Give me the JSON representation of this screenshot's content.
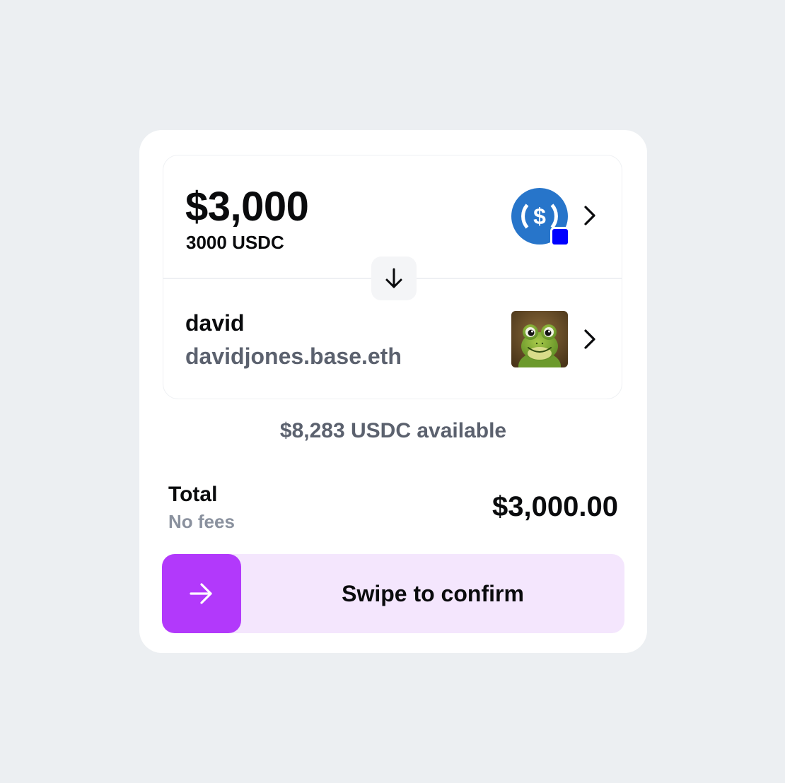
{
  "colors": {
    "background": "#eceff2",
    "card": "#ffffff",
    "usdc_blue": "#2775ca",
    "network_badge": "#0000ff",
    "swipe_track": "#f4e6fd",
    "swipe_handle": "#b239fb",
    "muted_text": "#5b616e"
  },
  "send": {
    "amount": "$3,000",
    "amount_token": "3000 USDC",
    "token_icon": "usdc-icon",
    "network_badge_icon": "base-network-icon"
  },
  "swap_icon": "arrow-down-icon",
  "recipient": {
    "name": "david",
    "address": "davidjones.base.eth",
    "avatar": "frog-avatar"
  },
  "available": "$8,283 USDC available",
  "total": {
    "label": "Total",
    "fees": "No fees",
    "value": "$3,000.00"
  },
  "confirm": {
    "label": "Swipe to confirm",
    "handle_icon": "arrow-right-icon"
  }
}
